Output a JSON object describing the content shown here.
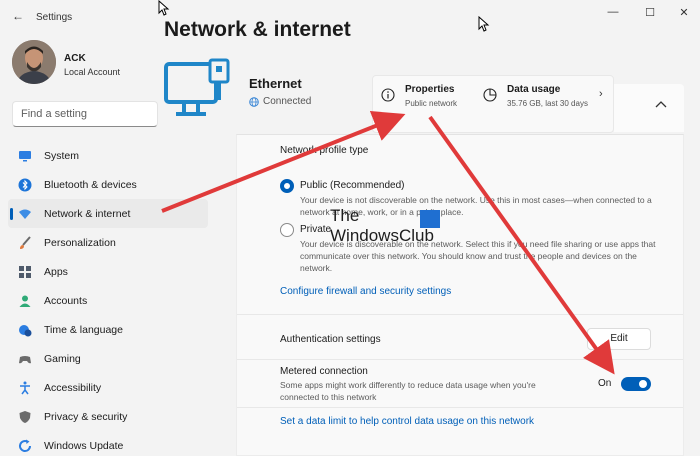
{
  "window": {
    "app_title": "Settings",
    "minimize_glyph": "—",
    "maximize_glyph": "☐",
    "close_glyph": "✕",
    "back_glyph": "←"
  },
  "profile": {
    "name": "ACK",
    "account_type": "Local Account"
  },
  "search": {
    "placeholder": "Find a setting"
  },
  "sidebar": {
    "items": [
      {
        "label": "System",
        "icon": "monitor-icon",
        "color": "#2b7de1"
      },
      {
        "label": "Bluetooth & devices",
        "icon": "bluetooth-icon",
        "color": "#1c74d8"
      },
      {
        "label": "Network & internet",
        "icon": "wifi-icon",
        "color": "#3d8de5",
        "active": true
      },
      {
        "label": "Personalization",
        "icon": "brush-icon",
        "color": "#e07a3e"
      },
      {
        "label": "Apps",
        "icon": "apps-icon",
        "color": "#4f5b6b"
      },
      {
        "label": "Accounts",
        "icon": "person-icon",
        "color": "#2faa77"
      },
      {
        "label": "Time & language",
        "icon": "clock-globe-icon",
        "color": "#2b7de1"
      },
      {
        "label": "Gaming",
        "icon": "gamepad-icon",
        "color": "#6b6b6b"
      },
      {
        "label": "Accessibility",
        "icon": "accessibility-icon",
        "color": "#2b7de1"
      },
      {
        "label": "Privacy & security",
        "icon": "shield-icon",
        "color": "#6b6b6b"
      },
      {
        "label": "Windows Update",
        "icon": "update-icon",
        "color": "#2b7de1"
      }
    ]
  },
  "main": {
    "page_title": "Network & internet",
    "connection": {
      "name": "Ethernet",
      "status": "Connected"
    },
    "properties": {
      "title": "Properties",
      "subtitle": "Public network"
    },
    "data_usage": {
      "title": "Data usage",
      "subtitle": "35.76 GB, last 30 days"
    },
    "network_profile": {
      "section_title": "Network profile type",
      "public_title": "Public (Recommended)",
      "public_desc": "Your device is not discoverable on the network. Use this in most cases—when connected to a network at home, work, or in a public place.",
      "private_title": "Private",
      "private_desc": "Your device is discoverable on the network. Select this if you need file sharing or use apps that communicate over this network. You should know and trust the people and devices on the network.",
      "selected": "public"
    },
    "firewall_link": "Configure firewall and security settings",
    "authentication": {
      "label": "Authentication settings",
      "button": "Edit"
    },
    "metered": {
      "title": "Metered connection",
      "desc": "Some apps might work differently to reduce data usage when you're connected to this network",
      "toggle_label": "On",
      "enabled": true
    },
    "data_limit_link": "Set a data limit to help control data usage on this network"
  },
  "watermark": {
    "line1": "The",
    "line2": "WindowsClub"
  },
  "colors": {
    "accent": "#005fb8",
    "annotation_arrow": "#e03a3a"
  }
}
